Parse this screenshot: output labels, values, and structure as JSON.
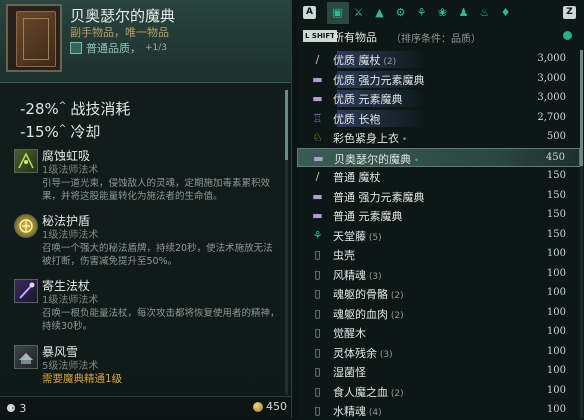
{
  "item": {
    "title": "贝奥瑟尔的魔典",
    "subtitle": "副手物品，唯一物品",
    "quality_label": "普通品质，",
    "quality_level": "+1/3"
  },
  "stats": [
    {
      "value": "-28%",
      "caret": "^",
      "label": "战技消耗"
    },
    {
      "value": "-15%",
      "caret": "^",
      "label": "冷却"
    }
  ],
  "abilities": [
    {
      "name": "腐蚀虹吸",
      "level": "1级法师法术",
      "desc": "引导一道光束，侵蚀敌人的灵魂，定期施加毒素累积效果，并将这股能量转化为施法者的生命值。",
      "icon": "siphon-icon"
    },
    {
      "name": "秘法护盾",
      "level": "1级法师法术",
      "desc": "召唤一个强大的秘法盾牌，持续20秒，使法术施放无法被打断，伤害减免提升至50%。",
      "icon": "arcane-shield-icon"
    },
    {
      "name": "寄生法杖",
      "level": "1级法师法术",
      "desc": "召唤一根负能量法杖，每次攻击都将恢复使用者的精神，持续30秒。",
      "icon": "parasite-staff-icon"
    },
    {
      "name": "暴风雪",
      "level": "5级法师法术",
      "requirement": "需要魔典精通1级",
      "icon": "blizzard-icon"
    }
  ],
  "footer": {
    "bag_count": "3",
    "gold": "450"
  },
  "inventory": {
    "key_left": "A",
    "key_right": "Z",
    "shift_label": "L SHIFT",
    "category": "所有物品",
    "sort": "（排序条件：品质）",
    "tab_icons": [
      "chest-icon",
      "swords-icon",
      "armor-icon",
      "potion-icon",
      "ingredient-icon",
      "herb-icon",
      "bag-icon",
      "lamp-icon",
      "gem-icon"
    ],
    "items": [
      {
        "name": "优质 魔杖",
        "count": "(2)",
        "price": "3,000",
        "icon": "wand-icon",
        "glow": true
      },
      {
        "name": "优质 强力元素魔典",
        "count": "",
        "price": "3,000",
        "icon": "tome-icon",
        "glow": true
      },
      {
        "name": "优质 元素魔典",
        "count": "",
        "price": "3,000",
        "icon": "tome-icon",
        "glow": true
      },
      {
        "name": "优质 长袍",
        "count": "",
        "price": "2,700",
        "icon": "robe-icon",
        "glow": true
      },
      {
        "name": "彩色紧身上衣",
        "count": "",
        "price": "500",
        "icon": "shirt-icon",
        "mark": "•"
      },
      {
        "name": "贝奥瑟尔的魔典",
        "count": "",
        "price": "450",
        "icon": "tome-icon",
        "mark": "•",
        "selected": true
      },
      {
        "name": "普通 魔杖",
        "count": "",
        "price": "150",
        "icon": "wand-icon"
      },
      {
        "name": "普通 强力元素魔典",
        "count": "",
        "price": "150",
        "icon": "tome-icon"
      },
      {
        "name": "普通 元素魔典",
        "count": "",
        "price": "150",
        "icon": "tome-icon"
      },
      {
        "name": "天堂藤",
        "count": "(5)",
        "price": "150",
        "icon": "vine-icon"
      },
      {
        "name": "虫壳",
        "count": "",
        "price": "100",
        "icon": "material-icon"
      },
      {
        "name": "风精魂",
        "count": "(3)",
        "price": "100",
        "icon": "material-icon"
      },
      {
        "name": "魂躯的骨骼",
        "count": "(2)",
        "price": "100",
        "icon": "material-icon"
      },
      {
        "name": "魂躯的血肉",
        "count": "(2)",
        "price": "100",
        "icon": "material-icon"
      },
      {
        "name": "觉醒木",
        "count": "",
        "price": "100",
        "icon": "material-icon"
      },
      {
        "name": "灵体残余",
        "count": "(3)",
        "price": "100",
        "icon": "material-icon"
      },
      {
        "name": "湿菌怪",
        "count": "",
        "price": "100",
        "icon": "material-icon"
      },
      {
        "name": "食人魔之血",
        "count": "(2)",
        "price": "100",
        "icon": "material-icon"
      },
      {
        "name": "水精魂",
        "count": "(4)",
        "price": "100",
        "icon": "material-icon"
      }
    ]
  },
  "colors": {
    "accent": "#27b08e",
    "warning": "#d9a03c",
    "selected_row": "#3b5c55"
  }
}
